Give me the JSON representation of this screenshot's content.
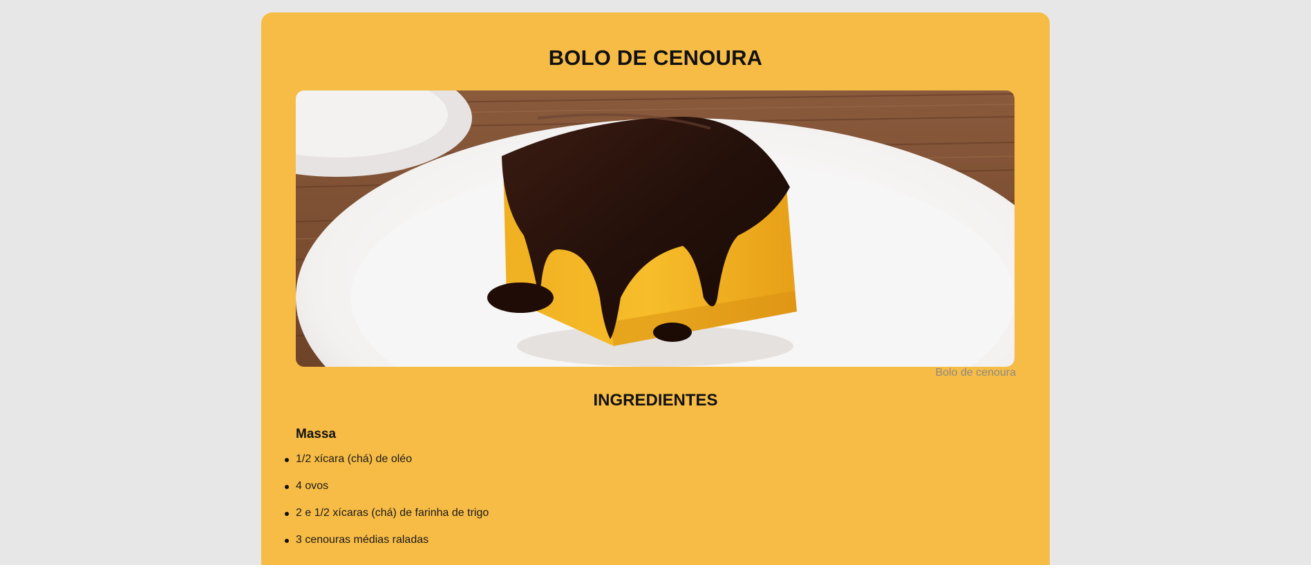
{
  "recipe": {
    "title": "BOLO DE CENOURA",
    "image_caption": "Bolo de cenoura",
    "ingredients_heading": "INGREDIENTES",
    "dough": {
      "heading": "Massa",
      "items": [
        "1/2 xícara (chá) de oléo",
        "4 ovos",
        "2 e 1/2 xícaras (chá) de farinha de trigo",
        "3 cenouras médias raladas"
      ]
    }
  },
  "colors": {
    "page_background": "#e8e7e7",
    "card_background": "#f7bc45",
    "caption_text": "#8c8a84"
  }
}
